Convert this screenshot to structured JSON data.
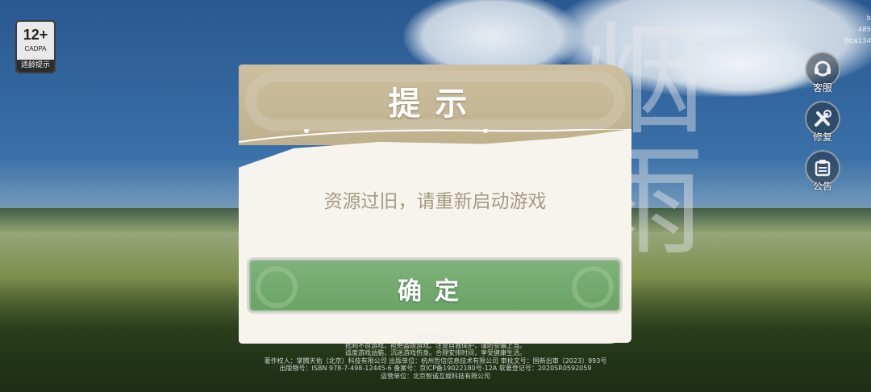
{
  "age_badge": {
    "rating": "12+",
    "org": "CADPA",
    "hint": "适龄提示"
  },
  "uid_text": [
    "b",
    "485",
    "bca134"
  ],
  "calligraphy": "烟雨",
  "side_buttons": [
    {
      "label": "客服",
      "icon": "headset-icon"
    },
    {
      "label": "修复",
      "icon": "wrench-icon"
    },
    {
      "label": "公告",
      "icon": "notice-icon"
    }
  ],
  "dialog": {
    "title": "提示",
    "message": "资源过旧，请重新启动游戏",
    "confirm_label": "确定"
  },
  "footer": {
    "heading": "健康游戏忠告",
    "lines": [
      "抵制不良游戏，拒绝盗版游戏。注意自我保护，谨防受骗上当。",
      "适度游戏益脑，沉迷游戏伤身。合理安排时间，享受健康生活。",
      "著作权人：掌腾天佑（北京）科技有限公司  出版单位：杭州哲信信息技术有限公司  审批文号：国新出审〔2023〕993号",
      "出版物号：ISBN 978-7-498-12445-6  备案号：京ICP备19022180号-12A  软著登记号：2020SR0592059",
      "运营单位：北京智诚互娱科技有限公司"
    ]
  },
  "colors": {
    "header": "#c4b692",
    "body": "#f7f4ee",
    "button": "#74ab70",
    "message": "#a89a83"
  }
}
